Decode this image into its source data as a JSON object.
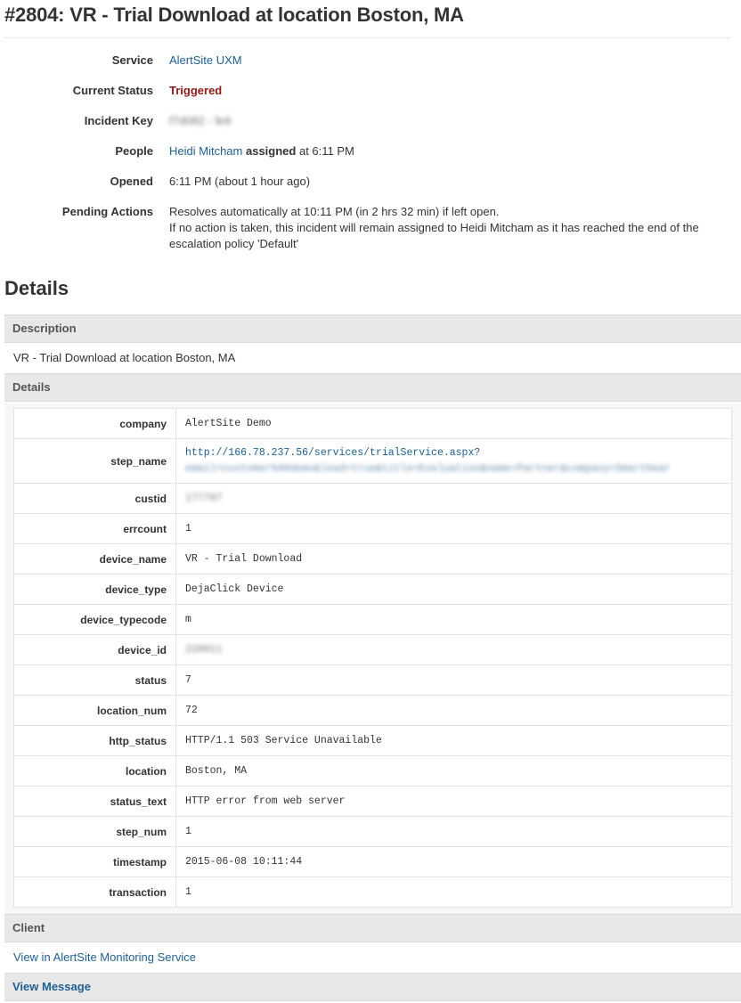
{
  "header": {
    "title": "#2804: VR - Trial Download at location Boston, MA"
  },
  "summary": {
    "service": {
      "label": "Service",
      "value": "AlertSite UXM"
    },
    "status": {
      "label": "Current Status",
      "value": "Triggered"
    },
    "incident_key": {
      "label": "Incident Key",
      "value": "f7d082 - fe9"
    },
    "people": {
      "label": "People",
      "name": "Heidi Mitcham",
      "action": "assigned",
      "time": "at 6:11 PM"
    },
    "opened": {
      "label": "Opened",
      "value": "6:11 PM (about 1 hour ago)"
    },
    "pending": {
      "label": "Pending Actions",
      "line1": "Resolves automatically at 10:11 PM (in 2 hrs 32 min) if left open.",
      "line2": "If no action is taken, this incident will remain assigned to Heidi Mitcham as it has reached the end of the escalation policy 'Default'"
    }
  },
  "details_section": {
    "title": "Details",
    "description_header": "Description",
    "description_text": "VR - Trial Download at location Boston, MA",
    "details_header": "Details",
    "rows": [
      {
        "key": "company",
        "value": "AlertSite Demo"
      },
      {
        "key": "step_name",
        "value": "http://166.78.237.56/services/trialService.aspx?",
        "value2": "email=customer%40demo&lead=true&title=Evaluation&name=Partner&company=Smartbear"
      },
      {
        "key": "custid",
        "value": "177787"
      },
      {
        "key": "errcount",
        "value": "1"
      },
      {
        "key": "device_name",
        "value": "VR - Trial Download"
      },
      {
        "key": "device_type",
        "value": "DejaClick Device"
      },
      {
        "key": "device_typecode",
        "value": "m"
      },
      {
        "key": "device_id",
        "value": "228911"
      },
      {
        "key": "status",
        "value": "7"
      },
      {
        "key": "location_num",
        "value": "72"
      },
      {
        "key": "http_status",
        "value": "HTTP/1.1 503 Service Unavailable"
      },
      {
        "key": "location",
        "value": "Boston, MA"
      },
      {
        "key": "status_text",
        "value": "HTTP error from web server"
      },
      {
        "key": "step_num",
        "value": "1"
      },
      {
        "key": "timestamp",
        "value": "2015-06-08 10:11:44"
      },
      {
        "key": "transaction",
        "value": "1"
      }
    ],
    "client_header": "Client",
    "client_link": "View in AlertSite Monitoring Service",
    "view_message": "View Message"
  },
  "colors": {
    "link": "#1f5f91",
    "triggered": "#8b1a1a",
    "bar_bg": "#e8e8e8"
  }
}
